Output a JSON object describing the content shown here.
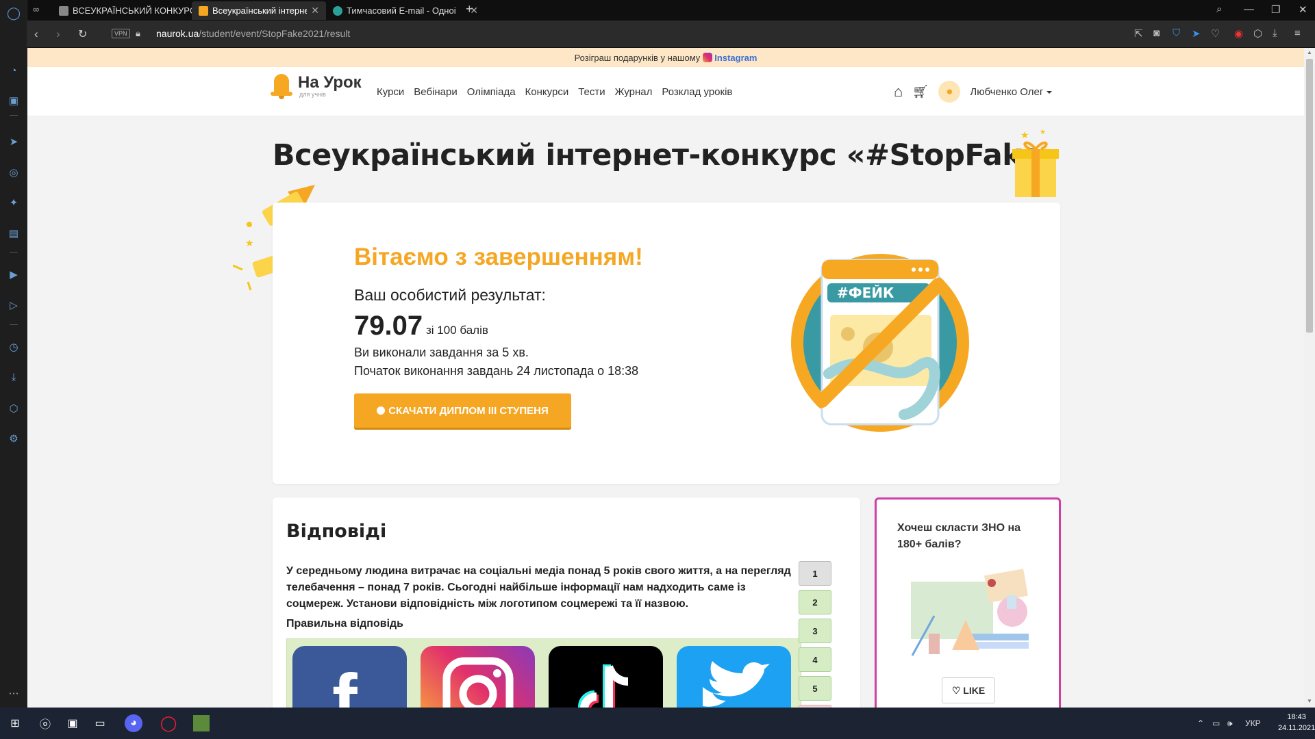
{
  "browser": {
    "tabs": [
      {
        "title": "ВСЕУКРАЇНСЬКИЙ КОНКУРС",
        "active": false
      },
      {
        "title": "Всеукраїнський інтернет-к",
        "active": true
      },
      {
        "title": "Тимчасовий E-mail - Одноі",
        "active": false
      }
    ],
    "new_tab_label": "+",
    "vpn_label": "VPN",
    "url_host": "naurok.ua",
    "url_path": "/student/event/StopFake2021/result"
  },
  "promo": {
    "text": "Розіграш подарунків у нашому",
    "link": "Instagram"
  },
  "site_nav": {
    "logo_title": "На Урок",
    "logo_sub": "для учнів",
    "menu": [
      "Курси",
      "Вебінари",
      "Олімпіада",
      "Конкурси",
      "Тести",
      "Журнал",
      "Розклад уроків"
    ],
    "user_name": "Любченко Олег"
  },
  "page_title": "Всеукраїнський інтернет-конкурс «#StopFake»",
  "result": {
    "congrats": "Вітаємо з завершенням!",
    "your_result": "Ваш особистий результат:",
    "score": "79.07",
    "out_of": "зі 100 балів",
    "time_text": "Ви виконали завдання за 5 хв.",
    "start_text": "Початок виконання завдань 24 листопада о 18:38",
    "download_button": "СКАЧАТИ ДИПЛОМ ІІІ СТУПЕНЯ",
    "illustration_label": "#ФЕЙК"
  },
  "answers": {
    "heading": "Відповіді",
    "question": "У середньому людина витрачає на соціальні медіа понад 5 років свого життя, а на перегляд телебачення – понад 7 років. Сьогодні найбільше інформації нам надходить саме із соцмереж. Установи відповідність між логотипом соцмережі та її назвою.",
    "correct_label": "Правильна відповідь",
    "logos": [
      "facebook",
      "instagram",
      "tiktok",
      "twitter"
    ],
    "question_numbers": [
      "1",
      "2",
      "3",
      "4",
      "5"
    ]
  },
  "zno_ad": {
    "text": "Хочеш скласти ЗНО на 180+ балів?",
    "like_button": "LIKE"
  },
  "taskbar": {
    "lang": "УКР",
    "time": "18:43",
    "date": "24.11.2021"
  },
  "colors": {
    "accent": "#f5a623",
    "promo_bg": "#fde7c6",
    "correct_bg": "#dcedc8",
    "zno_border": "#cf3fa6"
  }
}
